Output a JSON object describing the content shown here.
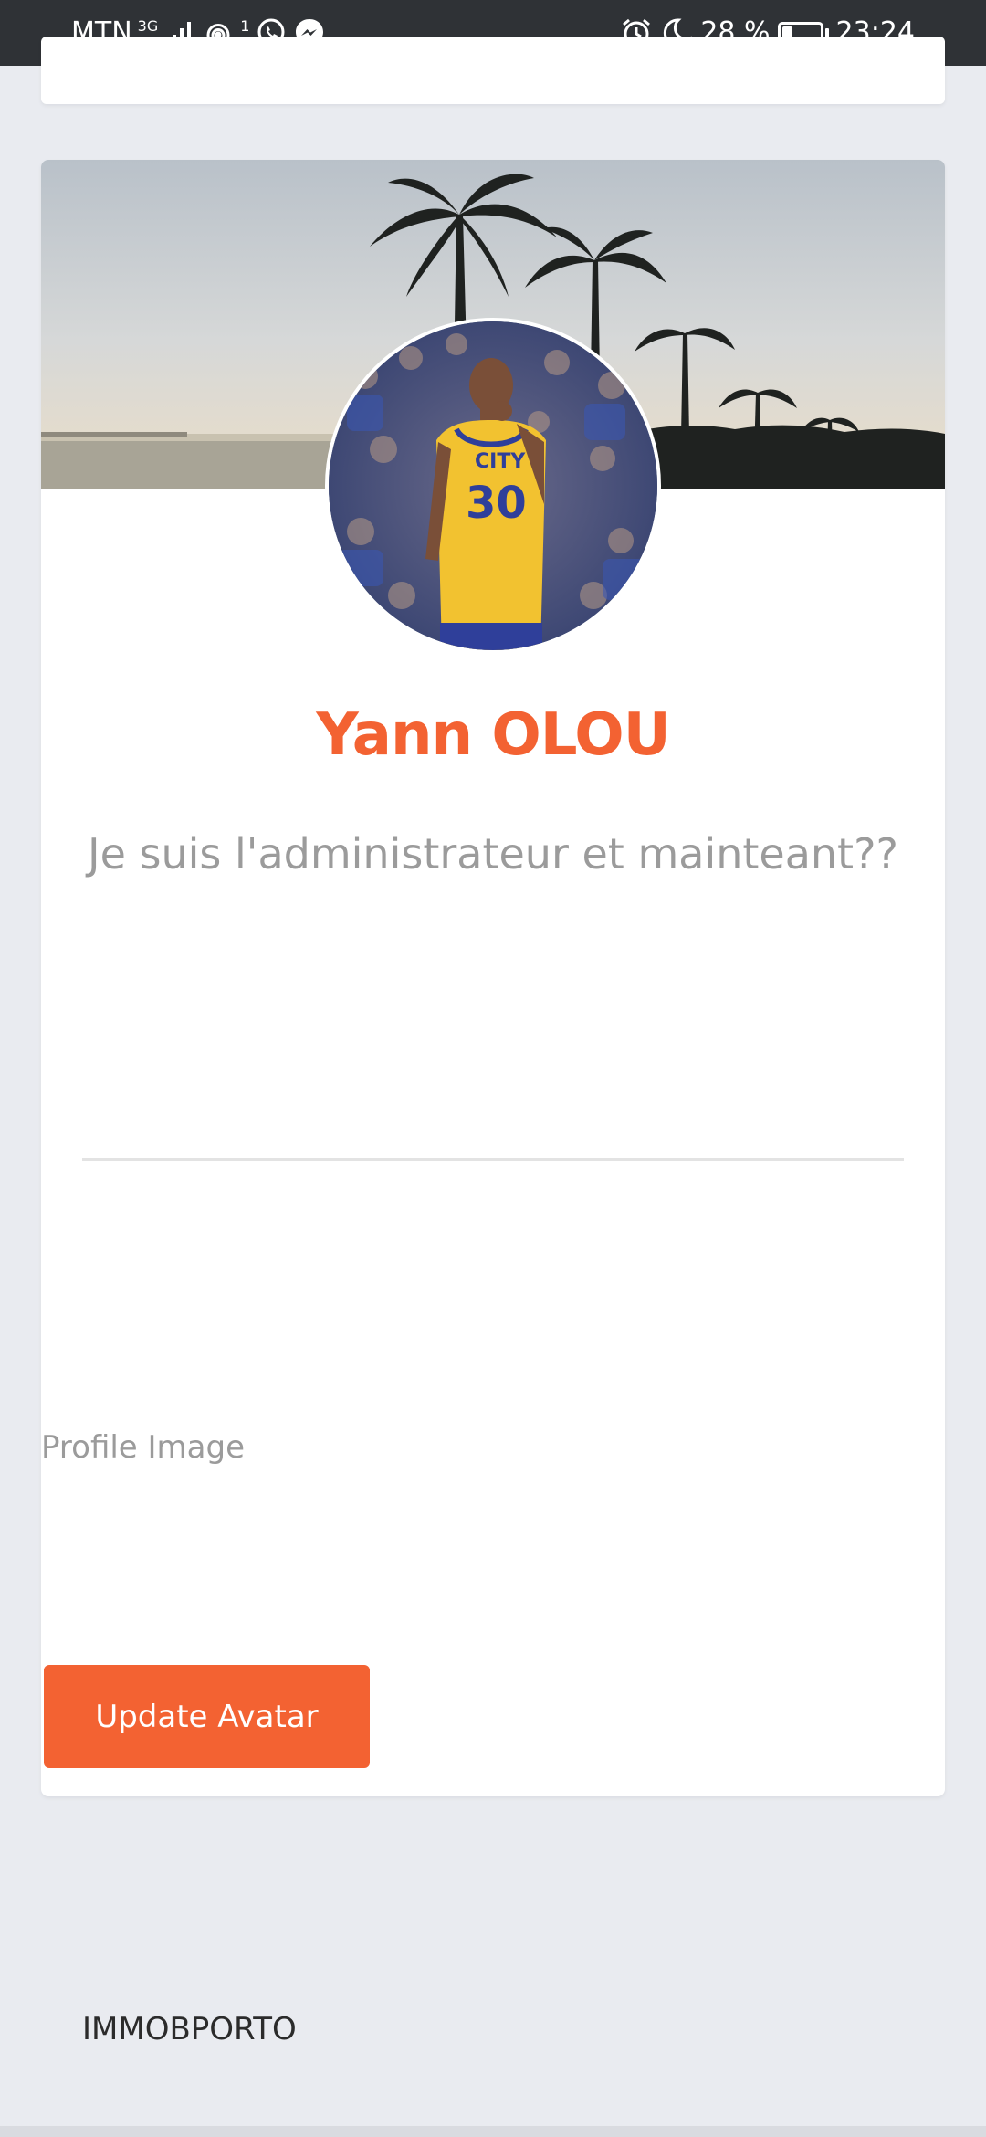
{
  "status_bar": {
    "carrier": "MTN",
    "network": "3G",
    "hotspot_count": "1",
    "battery_percent_text": "28 %",
    "battery_level": 0.28,
    "time": "23:24",
    "icons": [
      "signal-icon",
      "hotspot-icon",
      "whatsapp-icon",
      "messenger-icon",
      "alarm-icon",
      "moon-icon",
      "battery-icon"
    ]
  },
  "profile": {
    "name": "Yann OLOU",
    "bio": "Je suis l'administrateur et mainteant??",
    "profile_image_label": "Profile Image",
    "update_button_label": "Update Avatar"
  },
  "footer": {
    "brand": "IMMOBPORTO"
  },
  "colors": {
    "accent": "#f36232",
    "page_background": "#e9ebf0",
    "status_bar": "#2f3236"
  }
}
